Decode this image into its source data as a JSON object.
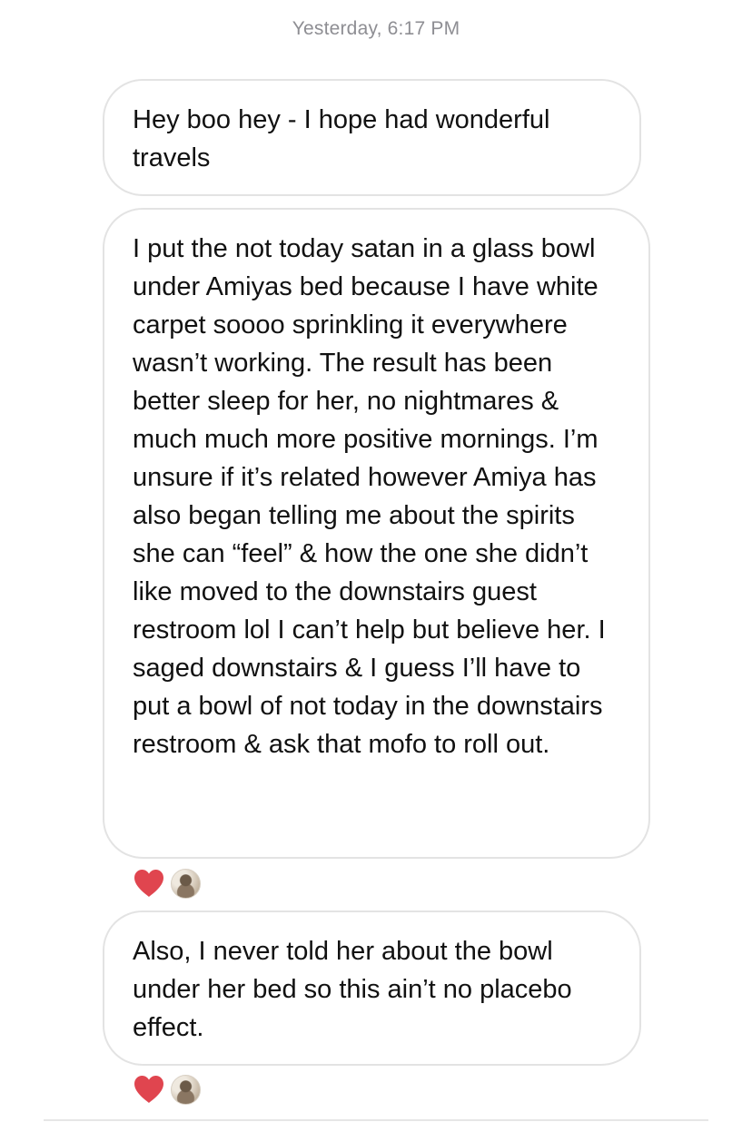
{
  "timestamp": "Yesterday, 6:17 PM",
  "messages": [
    {
      "text": "Hey boo hey - I hope had wonderful travels",
      "reactions": []
    },
    {
      "text": "I put the not today satan in a glass bowl under Amiyas bed because I have white carpet soooo sprinkling it everywhere wasn’t working. The result has been better sleep for her, no nightmares & much much more positive mornings. I’m unsure if it’s related however Amiya has also began telling me about the spirits she can “feel” & how the one she didn’t like moved to the downstairs guest restroom lol I can’t help but believe her. I saged downstairs & I guess I’ll have to put a bowl of not today in the downstairs restroom & ask that mofo to roll out.",
      "reactions": [
        {
          "icon": "heart-icon",
          "color": "#e0454f"
        }
      ]
    },
    {
      "text": "Also, I never told her about the bowl under her bed so this ain’t no placebo effect.",
      "reactions": [
        {
          "icon": "heart-icon",
          "color": "#e0454f"
        }
      ]
    }
  ],
  "colors": {
    "heart": "#e0454f",
    "bubble_border": "#e3e3e3",
    "timestamp": "#8e8e93"
  }
}
